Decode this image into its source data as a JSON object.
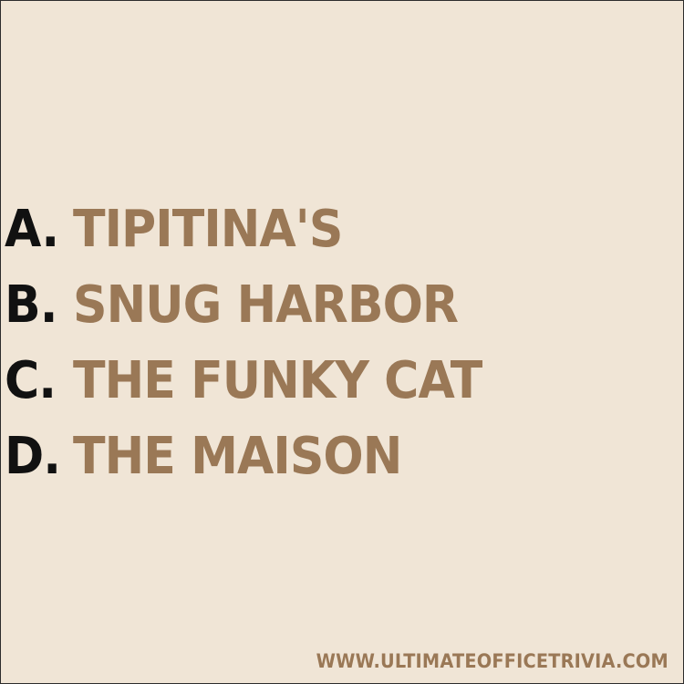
{
  "options": [
    {
      "letter": "A.",
      "text": "TIPITINA'S"
    },
    {
      "letter": "B.",
      "text": "SNUG HARBOR"
    },
    {
      "letter": "C.",
      "text": "THE FUNKY CAT"
    },
    {
      "letter": "D.",
      "text": "THE MAISON"
    }
  ],
  "footer": {
    "website": "WWW.ULTIMATEOFFICETRIVIA.COM"
  },
  "colors": {
    "background": "#f0e5d6",
    "letter": "#111111",
    "answer": "#9a7856",
    "border": "#2d2d2d"
  }
}
